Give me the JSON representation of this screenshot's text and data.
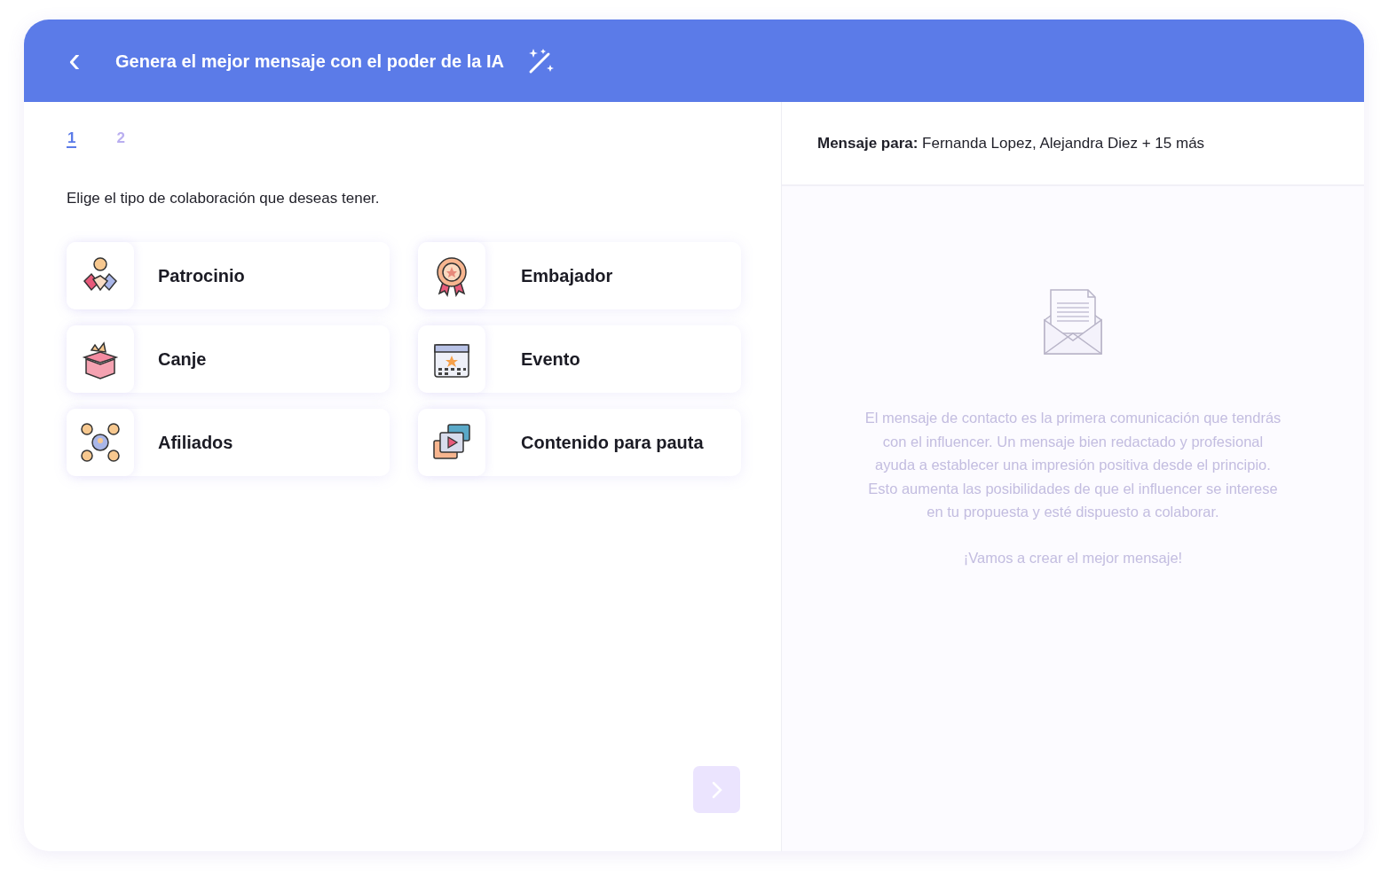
{
  "header": {
    "back": "‹",
    "title": "Genera el mejor mensaje con el poder de la IA"
  },
  "steps": [
    {
      "label": "1",
      "selected": true
    },
    {
      "label": "2",
      "selected": false
    }
  ],
  "prompt": "Elige el tipo de colaboración que deseas tener.",
  "options": [
    {
      "kind": "sponsorship",
      "label": "Patrocinio",
      "selected": false
    },
    {
      "kind": "ambassador",
      "label": "Embajador",
      "selected": false
    },
    {
      "kind": "exchange",
      "label": "Canje",
      "selected": false
    },
    {
      "kind": "event",
      "label": "Evento",
      "selected": false
    },
    {
      "kind": "affiliates",
      "label": "Afiliados",
      "selected": false
    },
    {
      "kind": "content",
      "label": "Contenido para pauta",
      "selected": false
    }
  ],
  "next_button": {
    "disabled": true
  },
  "recipients": {
    "label": "Mensaje para:",
    "value": "Fernanda Lopez, Alejandra Diez + 15 más"
  },
  "info": {
    "text": "El mensaje de contacto es la primera comunicación que tendrás con el influencer. Un mensaje bien redactado y profesional ayuda a establecer una impresión positiva desde el principio. Esto aumenta las posibilidades de que el influencer se interese en tu propuesta y esté dispuesto a colaborar.",
    "cta": "¡Vamos a crear el mejor mensaje!"
  }
}
